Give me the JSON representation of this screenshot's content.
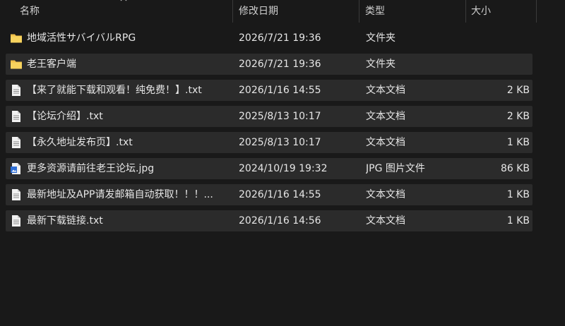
{
  "columns": {
    "name": "名称",
    "date": "修改日期",
    "type": "类型",
    "size": "大小"
  },
  "files": [
    {
      "name": "地域活性サバイバルRPG",
      "date": "2026/7/21 19:36",
      "type": "文件夹",
      "size": "",
      "icon": "folder-icon"
    },
    {
      "name": "老王客户端",
      "date": "2026/7/21 19:36",
      "type": "文件夹",
      "size": "",
      "icon": "folder-icon"
    },
    {
      "name": "【来了就能下载和观看！纯免费！】.txt",
      "date": "2026/1/16 14:55",
      "type": "文本文档",
      "size": "2 KB",
      "icon": "text-file-icon"
    },
    {
      "name": "【论坛介绍】.txt",
      "date": "2025/8/13 10:17",
      "type": "文本文档",
      "size": "2 KB",
      "icon": "text-file-icon"
    },
    {
      "name": "【永久地址发布页】.txt",
      "date": "2025/8/13 10:17",
      "type": "文本文档",
      "size": "1 KB",
      "icon": "text-file-icon"
    },
    {
      "name": "更多资源请前往老王论坛.jpg",
      "date": "2024/10/19 19:32",
      "type": "JPG 图片文件",
      "size": "86 KB",
      "icon": "image-file-icon"
    },
    {
      "name": "最新地址及APP请发邮箱自动获取！！！...",
      "date": "2026/1/16 14:55",
      "type": "文本文档",
      "size": "1 KB",
      "icon": "text-file-icon"
    },
    {
      "name": "最新下载链接.txt",
      "date": "2026/1/16 14:56",
      "type": "文本文档",
      "size": "1 KB",
      "icon": "text-file-icon"
    }
  ]
}
